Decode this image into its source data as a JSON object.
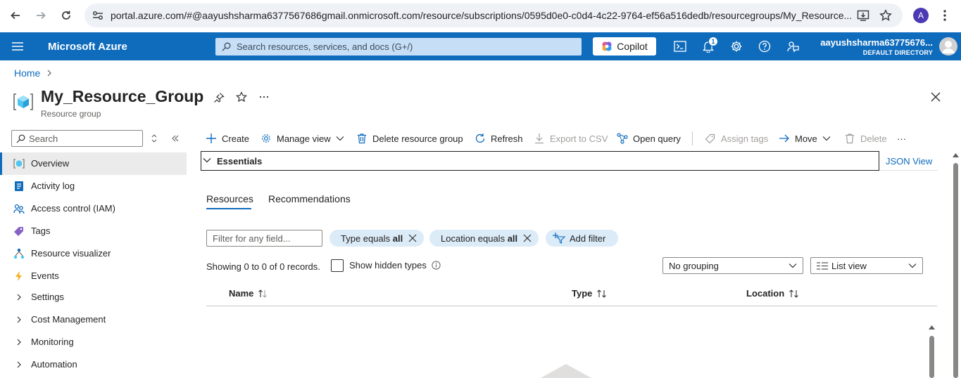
{
  "browser": {
    "url": "portal.azure.com/#@aayushsharma6377567686gmail.onmicrosoft.com/resource/subscriptions/0595d0e0-c0d4-4c22-9764-ef56a516dedb/resourcegroups/My_Resource...",
    "profile_initial": "A"
  },
  "header": {
    "brand": "Microsoft Azure",
    "search_placeholder": "Search resources, services, and docs (G+/)",
    "copilot_label": "Copilot",
    "notification_count": "1",
    "account_name": "aayushsharma63775676...",
    "account_directory": "DEFAULT DIRECTORY",
    "accent_color": "#0f6cbd"
  },
  "breadcrumb": {
    "home": "Home"
  },
  "page": {
    "title": "My_Resource_Group",
    "subtitle": "Resource group"
  },
  "sidebar": {
    "search_placeholder": "Search",
    "items": [
      {
        "label": "Overview",
        "icon": "resource-group-icon",
        "selected": true
      },
      {
        "label": "Activity log",
        "icon": "activity-log-icon"
      },
      {
        "label": "Access control (IAM)",
        "icon": "people-icon"
      },
      {
        "label": "Tags",
        "icon": "tag-icon"
      },
      {
        "label": "Resource visualizer",
        "icon": "visualizer-icon"
      },
      {
        "label": "Events",
        "icon": "lightning-icon"
      },
      {
        "label": "Settings",
        "icon": "chevron-right-icon"
      },
      {
        "label": "Cost Management",
        "icon": "chevron-right-icon"
      },
      {
        "label": "Monitoring",
        "icon": "chevron-right-icon"
      },
      {
        "label": "Automation",
        "icon": "chevron-right-icon"
      }
    ]
  },
  "toolbar": {
    "create": "Create",
    "manage_view": "Manage view",
    "delete_rg": "Delete resource group",
    "refresh": "Refresh",
    "export_csv": "Export to CSV",
    "open_query": "Open query",
    "assign_tags": "Assign tags",
    "move": "Move",
    "delete": "Delete",
    "more": "···"
  },
  "essentials": {
    "label": "Essentials",
    "json_view": "JSON View"
  },
  "tabs": [
    "Resources",
    "Recommendations"
  ],
  "filters": {
    "field_placeholder": "Filter for any field...",
    "type_prefix": "Type equals",
    "type_value": "all",
    "location_prefix": "Location equals",
    "location_value": "all",
    "add_filter": "Add filter"
  },
  "records": {
    "summary": "Showing 0 to 0 of 0 records.",
    "show_hidden": "Show hidden types"
  },
  "grouping": {
    "value": "No grouping"
  },
  "view": {
    "value": "List view"
  },
  "table": {
    "columns": [
      "Name",
      "Type",
      "Location"
    ]
  }
}
